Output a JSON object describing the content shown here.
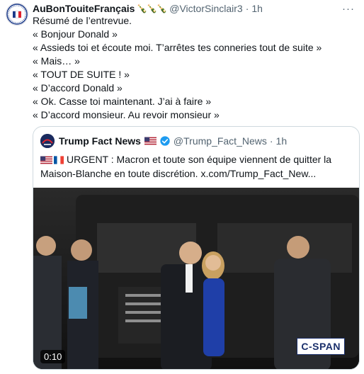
{
  "tweet": {
    "author_name": "AuBonTouiteFrançais",
    "author_emoji": "🍾🍾🍾",
    "handle": "@VictorSinclair3",
    "separator": "·",
    "time": "1h",
    "more_label": "···",
    "lines": [
      "Résumé de l’entrevue.",
      "« Bonjour Donald »",
      "« Assieds toi et écoute moi. T’arrêtes tes conneries tout de suite »",
      "« Mais… »",
      "« TOUT DE SUITE ! »",
      "« D’accord Donald »",
      "« Ok. Casse toi maintenant. J’ai à faire »",
      "« D’accord monsieur. Au revoir monsieur »"
    ]
  },
  "quoted": {
    "author_name": "Trump Fact News",
    "handle": "@Trump_Fact_News",
    "separator": "·",
    "time": "1h",
    "text_line1": "URGENT : Macron et toute son équipe viennent de quitter  la",
    "text_line2": "Maison-Blanche en toute discrétion.  x.com/Trump_Fact_New...",
    "video": {
      "timestamp": "0:10",
      "watermark": "C-SPAN"
    }
  },
  "colors": {
    "accent_blue": "#1d9bf0",
    "secondary_text": "#536471",
    "border": "#cfd9de"
  }
}
